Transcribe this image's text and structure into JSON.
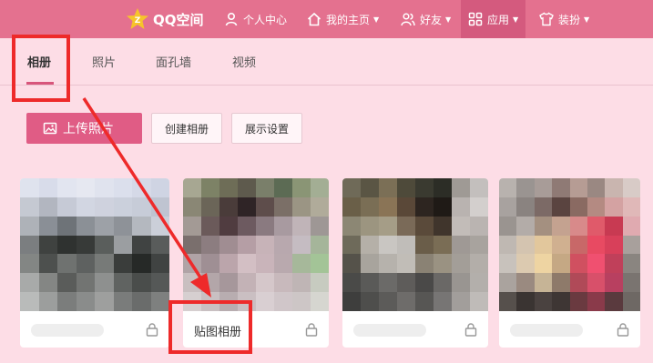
{
  "topnav": {
    "logo_text": "QQ空间",
    "items": [
      {
        "label": "个人中心",
        "icon": "user-icon"
      },
      {
        "label": "我的主页",
        "icon": "home-icon",
        "caret": "▼"
      },
      {
        "label": "好友",
        "icon": "friends-icon",
        "caret": "▼"
      },
      {
        "label": "应用",
        "icon": "apps-icon",
        "caret": "▼"
      },
      {
        "label": "装扮",
        "icon": "shirt-icon",
        "caret": "▼"
      }
    ]
  },
  "tabs": [
    {
      "label": "相册"
    },
    {
      "label": "照片"
    },
    {
      "label": "面孔墙"
    },
    {
      "label": "视频"
    }
  ],
  "toolbar": {
    "upload_label": "上传照片",
    "create_album_label": "创建相册",
    "display_settings_label": "展示设置"
  },
  "albums": [
    {
      "name": ""
    },
    {
      "name": "贴图相册"
    },
    {
      "name": ""
    },
    {
      "name": ""
    }
  ],
  "colors": {
    "nav_bg": "#e4718f",
    "page_bg": "#fddde6",
    "accent": "#e05c85",
    "annotation": "#ee2a2a"
  }
}
